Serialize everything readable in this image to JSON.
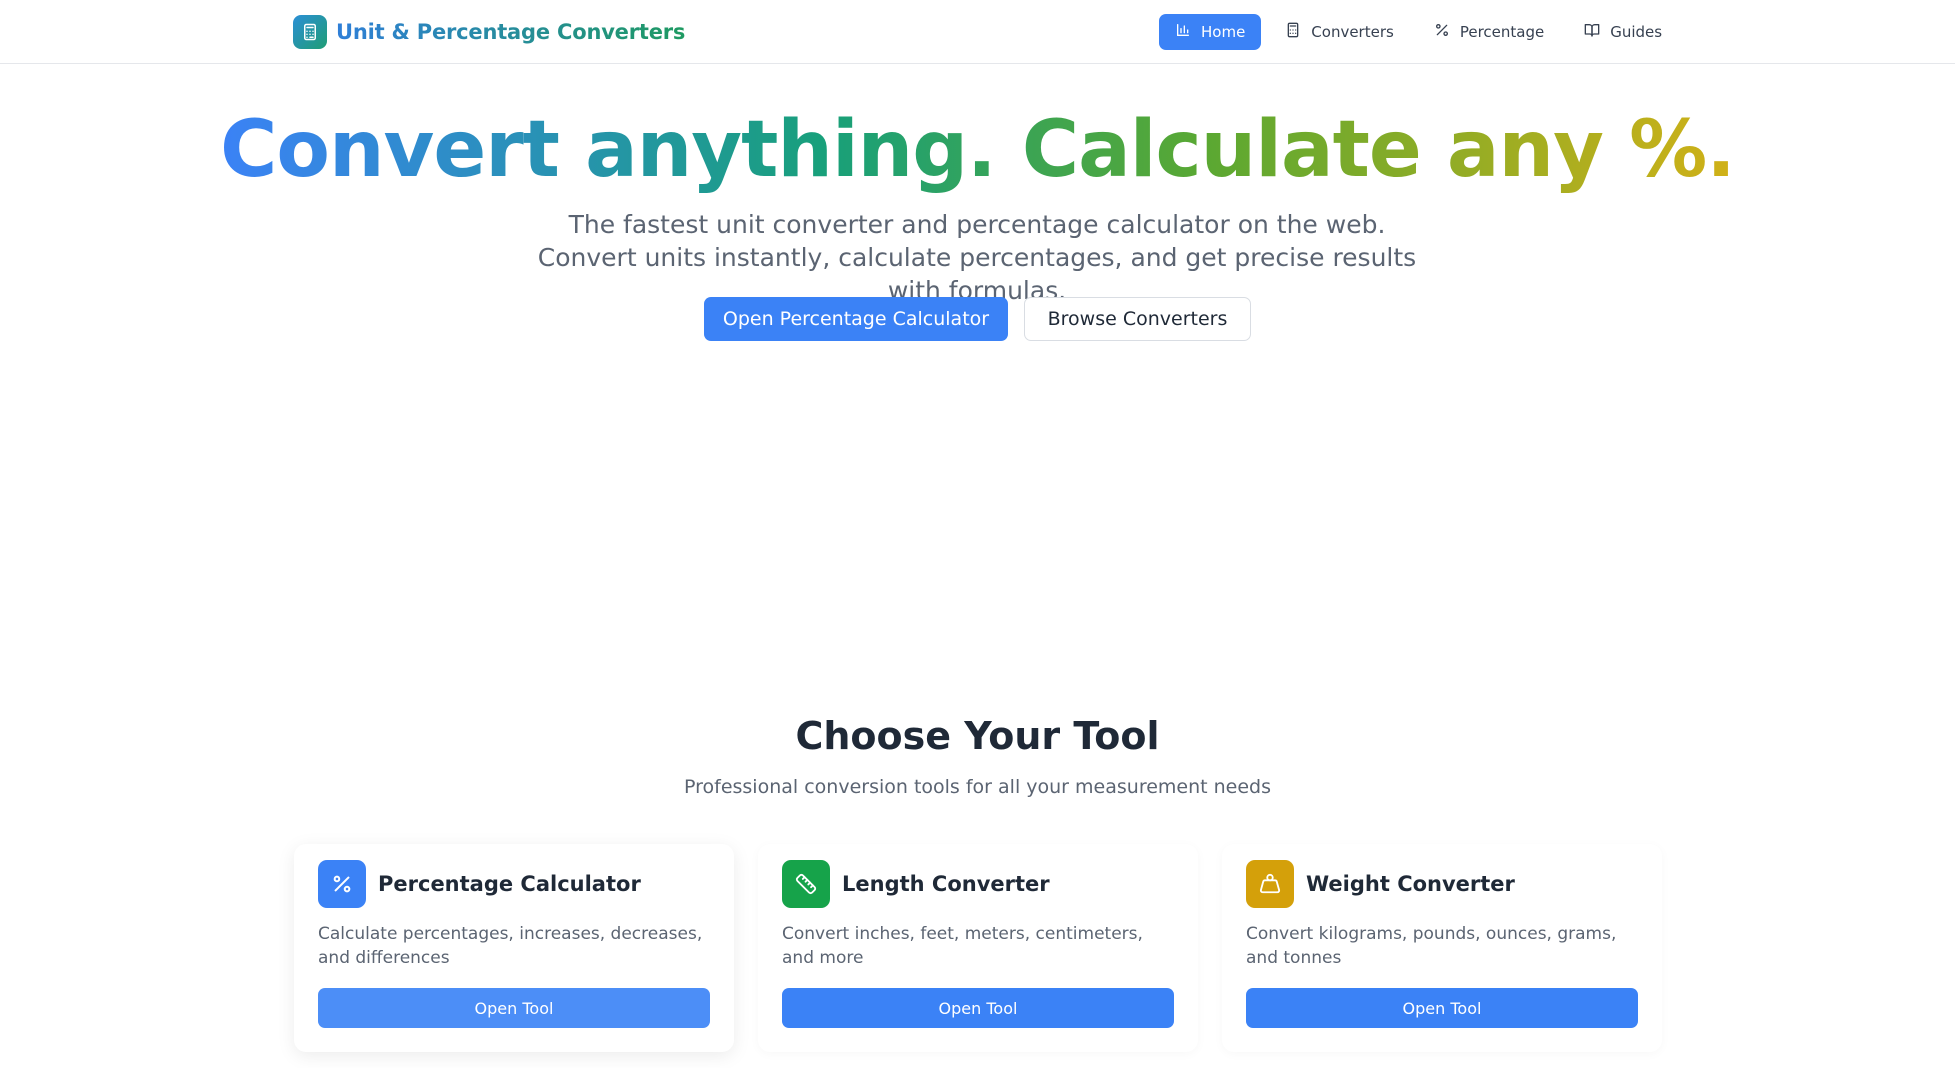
{
  "header": {
    "brand_title": "Unit & Percentage Converters",
    "nav": [
      {
        "label": "Home",
        "icon": "bar-chart-icon",
        "active": true
      },
      {
        "label": "Converters",
        "icon": "calculator-icon",
        "active": false
      },
      {
        "label": "Percentage",
        "icon": "percent-icon",
        "active": false
      },
      {
        "label": "Guides",
        "icon": "book-icon",
        "active": false
      }
    ]
  },
  "hero": {
    "title": "Convert anything. Calculate any %.",
    "subtitle": "The fastest unit converter and percentage calculator on the web. Convert units instantly, calculate percentages, and get precise results with formulas.",
    "primary_button": "Open Percentage Calculator",
    "secondary_button": "Browse Converters"
  },
  "tools_section": {
    "title": "Choose Your Tool",
    "subtitle": "Professional conversion tools for all your measurement needs",
    "cards": [
      {
        "title": "Percentage Calculator",
        "description": "Calculate percentages, increases, decreases, and differences",
        "button": "Open Tool",
        "icon": "percent-icon",
        "color": "#3b82f6"
      },
      {
        "title": "Length Converter",
        "description": "Convert inches, feet, meters, centimeters, and more",
        "button": "Open Tool",
        "icon": "ruler-icon",
        "color": "#16a34a"
      },
      {
        "title": "Weight Converter",
        "description": "Convert kilograms, pounds, ounces, grams, and tonnes",
        "button": "Open Tool",
        "icon": "weight-icon",
        "color": "#d4a00a"
      }
    ]
  },
  "colors": {
    "accent": "#3b82f6",
    "text": "#1f2937",
    "muted": "#5b6472"
  }
}
